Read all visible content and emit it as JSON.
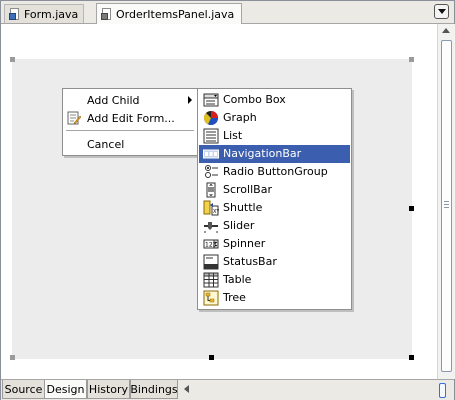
{
  "tabs": [
    {
      "label": "Form.java",
      "icon": "java-file-icon",
      "active": false
    },
    {
      "label": "OrderItemsPanel.java",
      "icon": "java-panel-file-icon",
      "active": true
    }
  ],
  "context_menu": {
    "items": [
      {
        "label": "Add Child",
        "has_submenu": true,
        "icon": ""
      },
      {
        "label": "Add Edit Form...",
        "has_submenu": false,
        "icon": "edit-form-icon"
      },
      {
        "label": "Cancel",
        "has_submenu": false,
        "icon": ""
      }
    ]
  },
  "submenu": {
    "selected": "NavigationBar",
    "items": [
      {
        "label": "Combo Box",
        "icon": "combo-box-icon"
      },
      {
        "label": "Graph",
        "icon": "graph-icon"
      },
      {
        "label": "List",
        "icon": "list-icon"
      },
      {
        "label": "NavigationBar",
        "icon": "navigation-bar-icon"
      },
      {
        "label": "Radio ButtonGroup",
        "icon": "radio-button-group-icon"
      },
      {
        "label": "ScrollBar",
        "icon": "scrollbar-icon"
      },
      {
        "label": "Shuttle",
        "icon": "shuttle-icon"
      },
      {
        "label": "Slider",
        "icon": "slider-icon"
      },
      {
        "label": "Spinner",
        "icon": "spinner-icon"
      },
      {
        "label": "StatusBar",
        "icon": "status-bar-icon"
      },
      {
        "label": "Table",
        "icon": "table-icon"
      },
      {
        "label": "Tree",
        "icon": "tree-icon"
      }
    ]
  },
  "bottom_tabs": [
    {
      "label": "Source",
      "active": false
    },
    {
      "label": "Design",
      "active": true
    },
    {
      "label": "History",
      "active": false
    },
    {
      "label": "Bindings",
      "active": false
    }
  ],
  "colors": {
    "selection": "#3b5fae",
    "canvas": "#ececec",
    "chrome": "#eceae4"
  }
}
